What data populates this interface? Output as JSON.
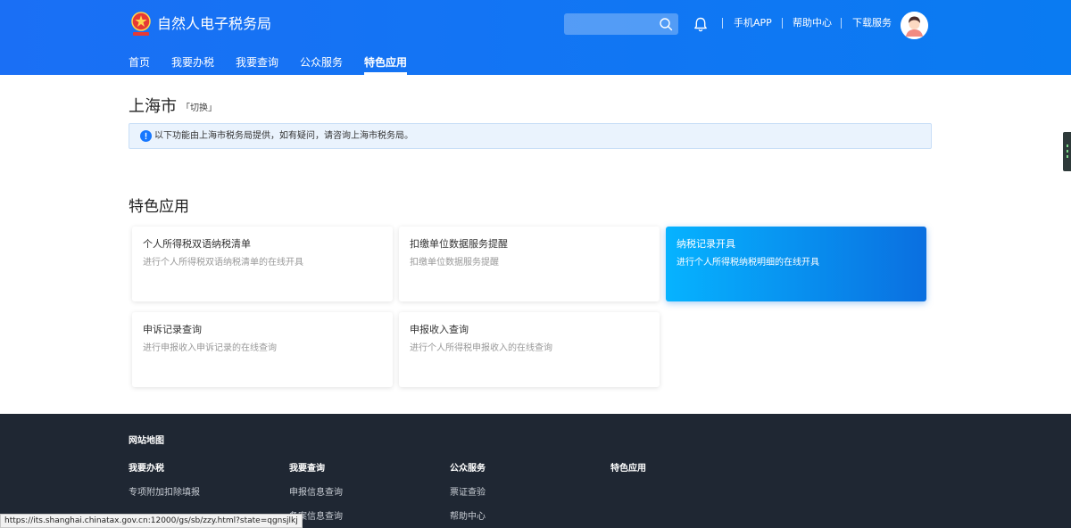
{
  "header": {
    "site_title": "自然人电子税务局",
    "search": {
      "placeholder": ""
    },
    "links": [
      "手机APP",
      "帮助中心",
      "下载服务"
    ],
    "nav": [
      "首页",
      "我要办税",
      "我要查询",
      "公众服务",
      "特色应用"
    ],
    "active_nav": "特色应用"
  },
  "location": {
    "city": "上海市",
    "switch_label": "「切换」"
  },
  "notice": {
    "text": "以下功能由上海市税务局提供，如有疑问，请咨询上海市税务局。"
  },
  "section": {
    "title": "特色应用",
    "cards": [
      {
        "title": "个人所得税双语纳税清单",
        "desc": "进行个人所得税双语纳税清单的在线开具",
        "active": false
      },
      {
        "title": "扣缴单位数据服务提醒",
        "desc": "扣缴单位数据服务提醒",
        "active": false
      },
      {
        "title": "纳税记录开具",
        "desc": "进行个人所得税纳税明细的在线开具",
        "active": true
      },
      {
        "title": "申诉记录查询",
        "desc": "进行申报收入申诉记录的在线查询",
        "active": false
      },
      {
        "title": "申报收入查询",
        "desc": "进行个人所得税申报收入的在线查询",
        "active": false
      }
    ]
  },
  "footer": {
    "heading": "网站地图",
    "columns": [
      {
        "title": "我要办税",
        "links": [
          "专项附加扣除填报"
        ]
      },
      {
        "title": "我要查询",
        "links": [
          "申报信息查询",
          "备案信息查询"
        ]
      },
      {
        "title": "公众服务",
        "links": [
          "票证查验",
          "帮助中心"
        ]
      },
      {
        "title": "特色应用",
        "links": []
      }
    ]
  },
  "status_bar": {
    "url": "https://its.shanghai.chinatax.gov.cn:12000/gs/sb/zzy.html?state=qgnsjlkj"
  },
  "colors": {
    "header_blue": "#1a6ff5",
    "active_card_start": "#06b3ff",
    "active_card_end": "#0a6fe0",
    "footer_bg": "#1f2733",
    "notice_bg": "#eaf3fd"
  }
}
